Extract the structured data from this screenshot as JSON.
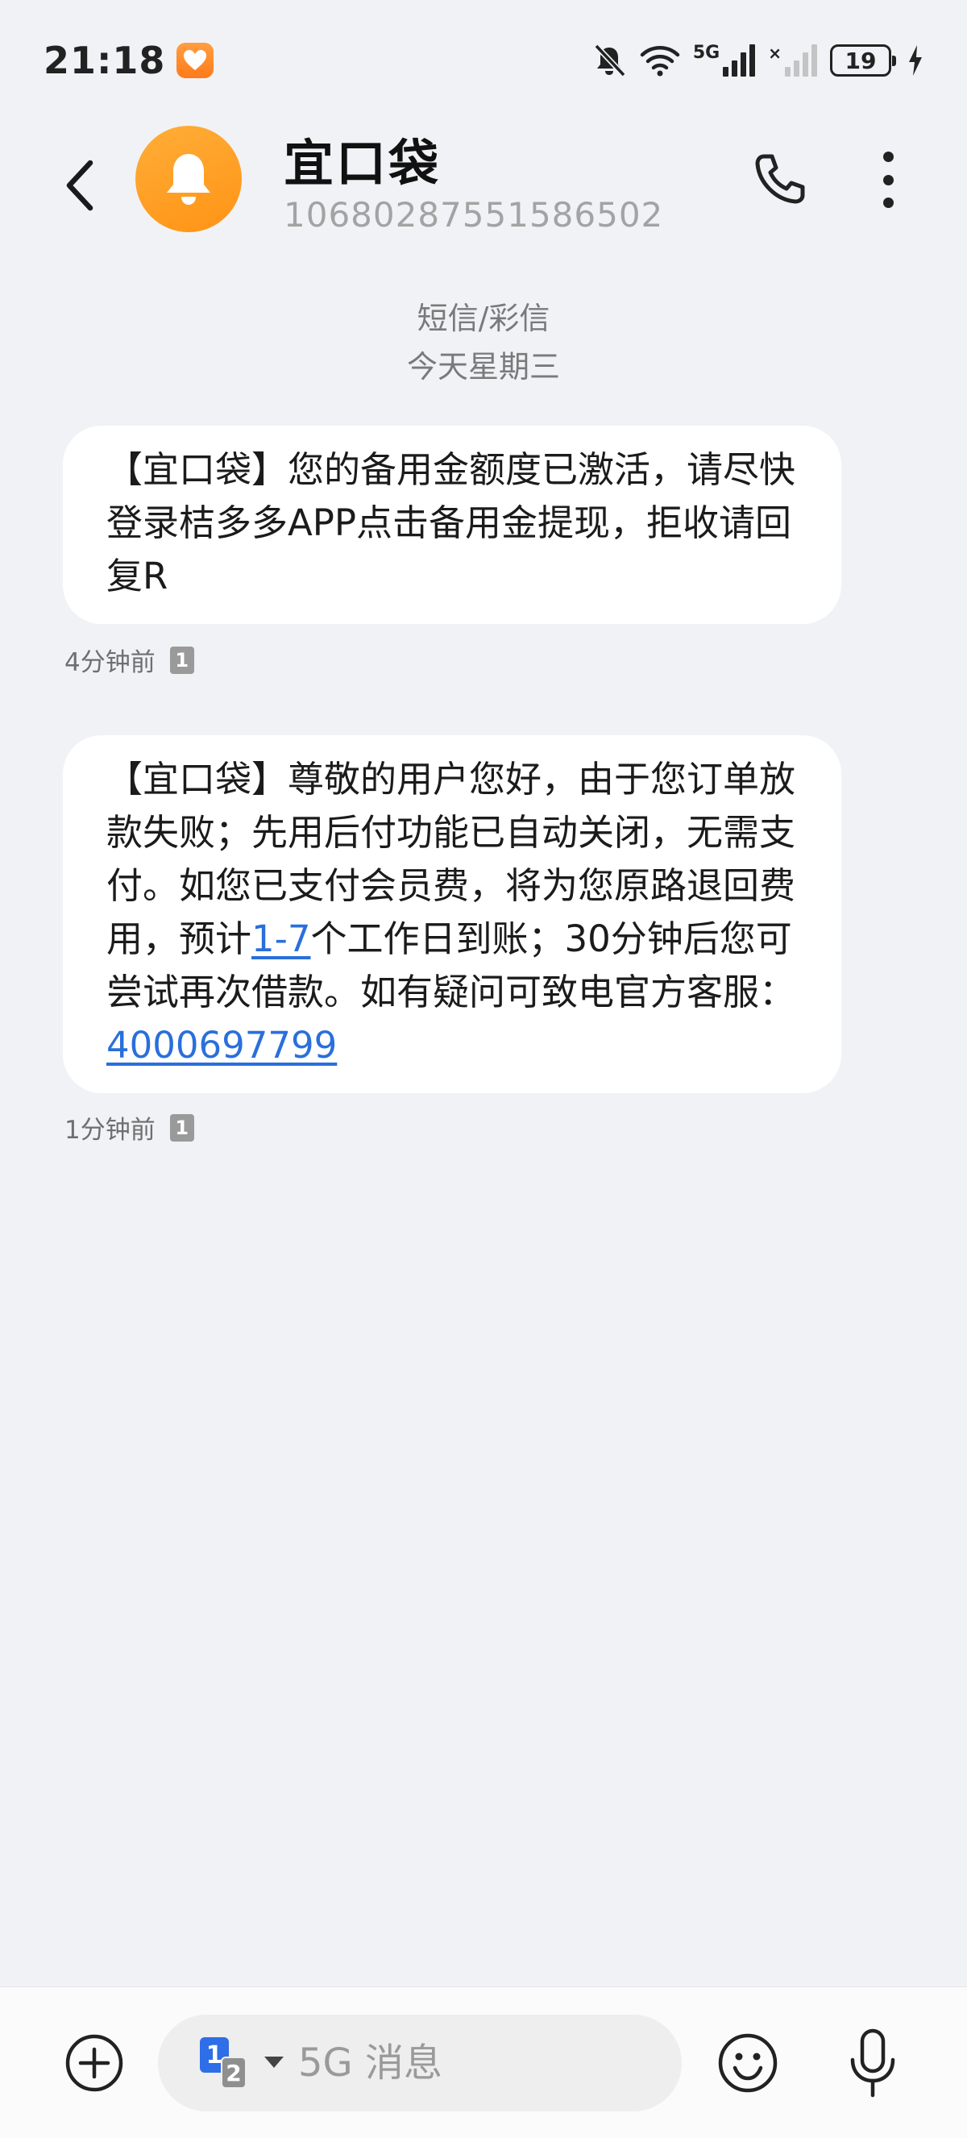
{
  "status_bar": {
    "time": "21:18",
    "network_label": "5G",
    "battery_level": "19",
    "icons": [
      "heart-app-icon",
      "mute-icon",
      "wifi-icon",
      "signal-5g-icon",
      "signal-secondary-icon",
      "battery-icon",
      "charging-icon"
    ]
  },
  "header": {
    "contact_name": "宜口袋",
    "contact_number": "10680287551586502",
    "avatar_icon": "bell-icon",
    "back_icon": "chevron-left-icon",
    "call_icon": "phone-icon",
    "more_icon": "more-vertical-icon"
  },
  "thread": {
    "channel_label": "短信/彩信",
    "date_label": "今天星期三"
  },
  "messages": [
    {
      "text": "【宜口袋】您的备用金额度已激活，请尽快登录桔多多APP点击备用金提现，拒收请回复R",
      "time": "4分钟前",
      "sim": "1"
    },
    {
      "text_before_link1": "【宜口袋】尊敬的用户您好，由于您订单放款失败；先用后付功能已自动关闭，无需支付。如您已支付会员费，将为您原路退回费用，预计",
      "link1": "1-7",
      "text_between": "个工作日到账；30分钟后您可尝试再次借款。如有疑问可致电官方客服：",
      "link2": "4000697799",
      "time": "1分钟前",
      "sim": "1"
    }
  ],
  "composer": {
    "placeholder": "5G 消息",
    "sim_primary": "1",
    "sim_secondary": "2",
    "add_icon": "plus-circle-icon",
    "emoji_icon": "emoji-icon",
    "mic_icon": "microphone-icon"
  },
  "colors": {
    "background": "#f1f2f6",
    "bubble": "#ffffff",
    "link": "#2a6fdb",
    "avatar": "#ff9f20",
    "sim_primary": "#2e6ee6"
  }
}
